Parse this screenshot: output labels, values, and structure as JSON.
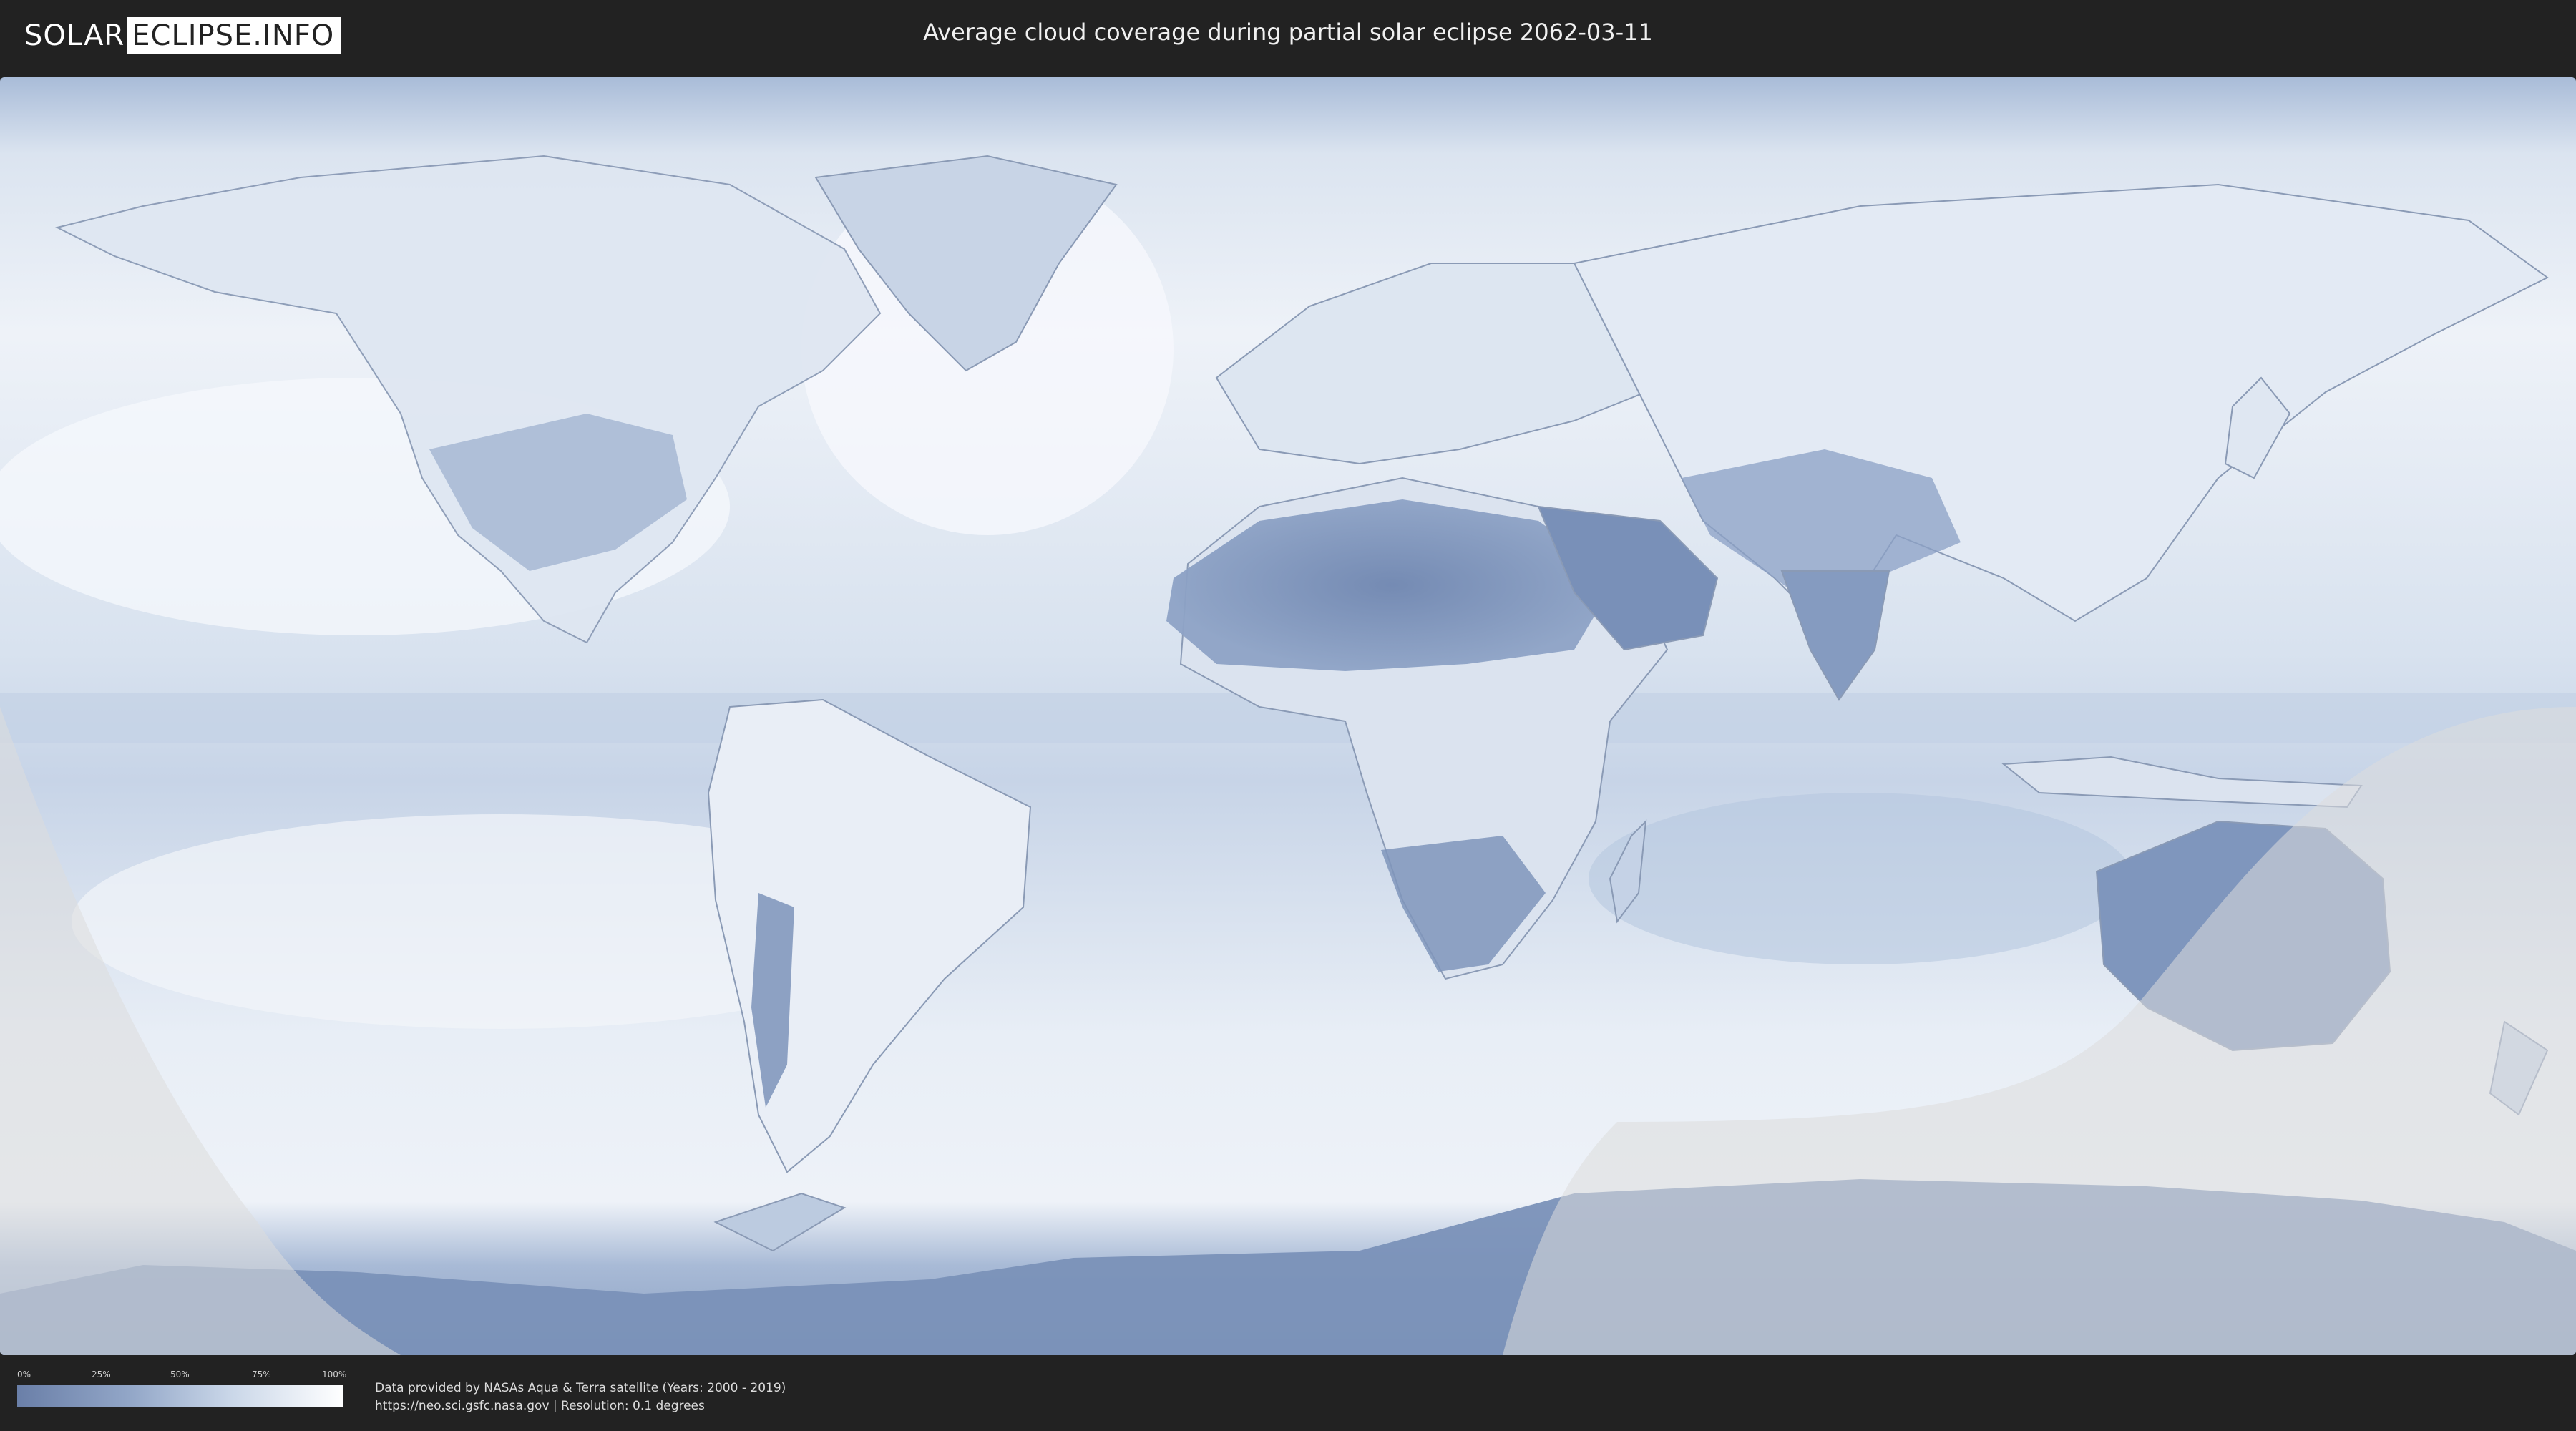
{
  "header": {
    "logo_left": "SOLAR",
    "logo_right": "ECLIPSE.INFO",
    "title": "Average cloud coverage during partial solar eclipse 2062-03-11"
  },
  "legend": {
    "ticks": [
      "0%",
      "25%",
      "50%",
      "75%",
      "100%"
    ],
    "color_low": "#6a7fa8",
    "color_high": "#ffffff"
  },
  "credits": {
    "line1": "Data provided by NASAs Aqua & Terra satellite (Years: 2000 - 2019)",
    "line2": "https://neo.sci.gsfc.nasa.gov | Resolution: 0.1 degrees"
  },
  "colors": {
    "background": "#222222",
    "ocean_cloud": "#e6edf6",
    "land_clear": "#7b93ba",
    "shadow_overlay": "#dcdcdc"
  }
}
